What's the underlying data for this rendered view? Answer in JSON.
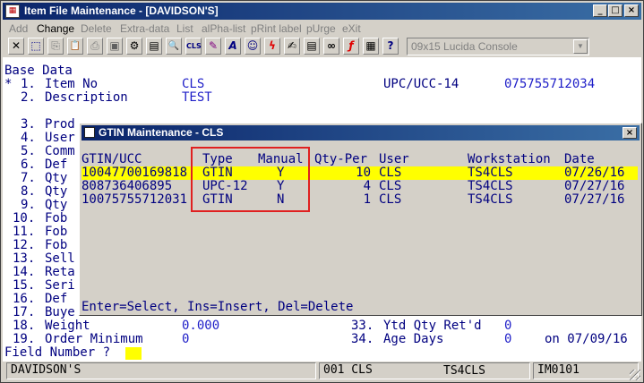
{
  "window": {
    "title": "Item File Maintenance - [DAVIDSON'S]",
    "app_icon": "item-app-icon",
    "controls": {
      "minimize": "_",
      "maximize": "□",
      "close": "×"
    }
  },
  "menu": [
    {
      "label": "Add",
      "enabled": false
    },
    {
      "label": "Change",
      "enabled": true
    },
    {
      "label": "Delete",
      "enabled": false
    },
    {
      "label": "Extra-data",
      "enabled": false
    },
    {
      "label": "List",
      "enabled": false
    },
    {
      "label": "alPha-list",
      "enabled": false
    },
    {
      "label": "pRint label",
      "enabled": false
    },
    {
      "label": "pUrge",
      "enabled": false
    },
    {
      "label": "eXit",
      "enabled": false
    }
  ],
  "toolbar": {
    "font_select": "09x15 Lucida Console",
    "tools": [
      {
        "name": "exit-x-icon",
        "glyph": "✕"
      },
      {
        "name": "select-box-icon",
        "glyph": "⬚"
      },
      {
        "name": "copy-icon",
        "glyph": "⎘"
      },
      {
        "name": "paste-icon",
        "glyph": "📋"
      },
      {
        "name": "print-icon",
        "glyph": "⎙"
      },
      {
        "name": "save-icon",
        "glyph": "▣"
      },
      {
        "name": "settings-icon",
        "glyph": "⚙"
      },
      {
        "name": "memo-icon",
        "glyph": "▤"
      },
      {
        "name": "lookup-icon",
        "glyph": "🔍"
      },
      {
        "name": "cls-icon",
        "glyph": "CLS"
      },
      {
        "name": "wizard-icon",
        "glyph": "✎"
      },
      {
        "name": "font-icon",
        "glyph": "A"
      },
      {
        "name": "person-icon",
        "glyph": "☺"
      },
      {
        "name": "lightning-icon",
        "glyph": "ϟ"
      },
      {
        "name": "notepad-icon",
        "glyph": "✍"
      },
      {
        "name": "link-icon",
        "glyph": "∞"
      },
      {
        "name": "function-icon",
        "glyph": "ƒ"
      },
      {
        "name": "calculator-icon",
        "glyph": "▦"
      },
      {
        "name": "help-icon",
        "glyph": "?"
      }
    ]
  },
  "screen": {
    "section_title": "Base Data",
    "field1": {
      "marker": "*",
      "num": "1.",
      "label": "Item No",
      "value": "CLS"
    },
    "field2": {
      "num": "2.",
      "label": "Description",
      "value": "TEST"
    },
    "upc_label": "UPC/UCC-14",
    "upc_value": "075755712034",
    "left_fields": [
      {
        "num": "3.",
        "label": "Prod"
      },
      {
        "num": "4.",
        "label": "User"
      },
      {
        "num": "5.",
        "label": "Comm"
      },
      {
        "num": "6.",
        "label": "Def"
      },
      {
        "num": "7.",
        "label": "Qty"
      },
      {
        "num": "8.",
        "label": "Qty"
      },
      {
        "num": "9.",
        "label": "Qty"
      },
      {
        "num": "10.",
        "label": "Fob"
      },
      {
        "num": "11.",
        "label": "Fob"
      },
      {
        "num": "12.",
        "label": "Fob"
      },
      {
        "num": "13.",
        "label": "Sell"
      },
      {
        "num": "14.",
        "label": "Reta"
      },
      {
        "num": "15.",
        "label": "Seri"
      },
      {
        "num": "16.",
        "label": "Def"
      },
      {
        "num": "17.",
        "label": "Buye"
      }
    ],
    "field18": {
      "num": "18.",
      "label": "Weight",
      "value": "0.000"
    },
    "field19": {
      "num": "19.",
      "label": "Order Minimum",
      "value": "0"
    },
    "field33": {
      "num": "33.",
      "label": "Ytd Qty Ret'd",
      "value": "0"
    },
    "field34": {
      "num": "34.",
      "label": "Age Days",
      "value": "0",
      "extra": "on 07/09/16"
    },
    "prompt": "Field Number ?"
  },
  "dialog": {
    "title": "GTIN Maintenance - CLS",
    "close": "×",
    "headers": {
      "gtin": "GTIN/UCC",
      "type": "Type",
      "manual": "Manual",
      "qty": "Qty-Per",
      "user": "User",
      "ws": "Workstation",
      "date": "Date"
    },
    "rows": [
      {
        "gtin": "10047700169818",
        "type": "GTIN",
        "manual": "Y",
        "qty": "10",
        "user": "CLS",
        "ws": "TS4CLS",
        "date": "07/26/16"
      },
      {
        "gtin": "808736406895",
        "type": "UPC-12",
        "manual": "Y",
        "qty": "4",
        "user": "CLS",
        "ws": "TS4CLS",
        "date": "07/27/16"
      },
      {
        "gtin": "10075755712031",
        "type": "GTIN",
        "manual": "N",
        "qty": "1",
        "user": "CLS",
        "ws": "TS4CLS",
        "date": "07/27/16"
      }
    ],
    "footer": "Enter=Select, Ins=Insert, Del=Delete"
  },
  "status": {
    "company": "DAVIDSON'S",
    "session": "001 CLS",
    "workstation": "TS4CLS",
    "program": "IM0101"
  },
  "colors": {
    "highlight": "#ffff00",
    "terminal_text": "#000080",
    "annotation_box": "#e02020"
  }
}
